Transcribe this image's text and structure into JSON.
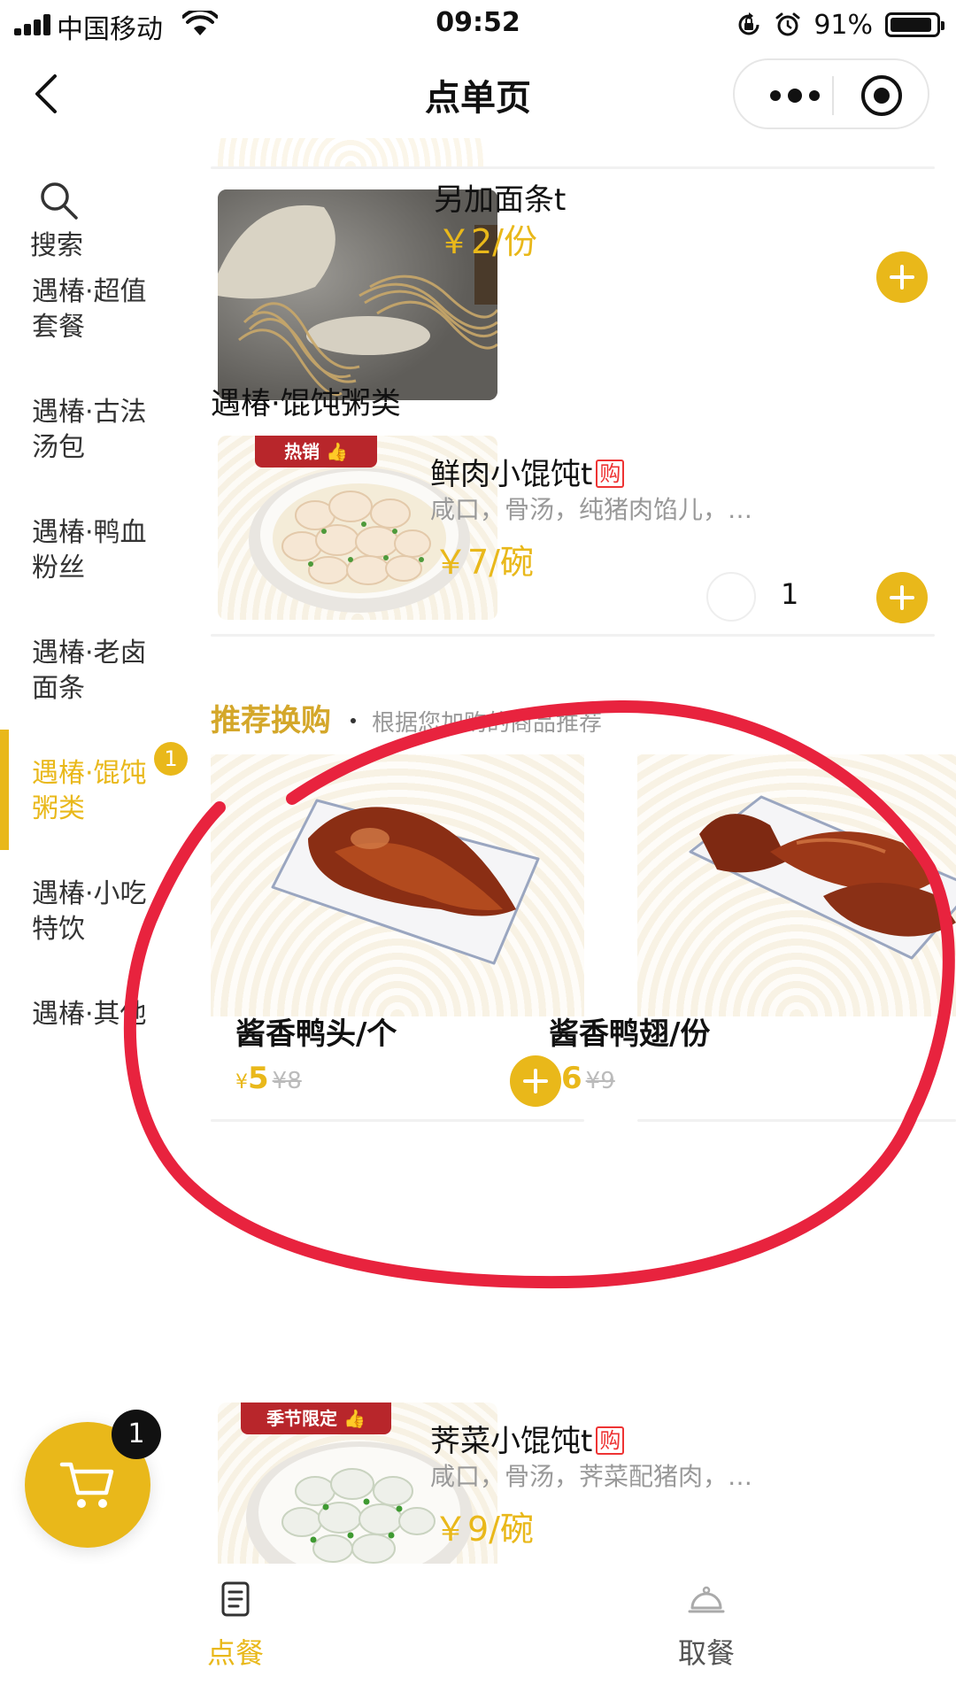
{
  "status_bar": {
    "carrier": "中国移动",
    "time": "09:52",
    "battery_percent": "91%",
    "battery_level": 0.91
  },
  "navbar": {
    "title": "点单页"
  },
  "sidebar": {
    "search_label": "搜索",
    "categories": [
      {
        "line1": "遇椿·超值",
        "line2": "套餐"
      },
      {
        "line1": "遇椿·古法",
        "line2": "汤包"
      },
      {
        "line1": "遇椿·鸭血",
        "line2": "粉丝"
      },
      {
        "line1": "遇椿·老卤",
        "line2": "面条"
      },
      {
        "line1": "遇椿·馄饨",
        "line2": "粥类",
        "badge": "1"
      },
      {
        "line1": "遇椿·小吃",
        "line2": "特饮"
      },
      {
        "line1": "遇椿·其他",
        "line2": ""
      }
    ]
  },
  "items": {
    "extra_noodles": {
      "name": "另加面条t",
      "price": "￥2/份"
    },
    "section_wonton": "遇椿·馄饨粥类",
    "fresh_wonton": {
      "tag": "热销",
      "name": "鲜肉小馄饨t",
      "buy_tag": "购",
      "desc": "咸口，骨汤，纯猪肉馅儿，…",
      "price": "￥7/碗",
      "qty": "1"
    },
    "shepherd_wonton": {
      "tag": "季节限定",
      "name": "荠菜小馄饨t",
      "buy_tag": "购",
      "desc": "咸口，骨汤，荠菜配猪肉，…",
      "price": "￥9/碗"
    }
  },
  "recommend": {
    "title": "推荐换购",
    "subtitle": "根据您加购的商品推荐",
    "cards": [
      {
        "name": "酱香鸭头/个",
        "currency": "¥",
        "price": "5",
        "old_price": "¥8"
      },
      {
        "name": "酱香鸭翅/份",
        "currency": "¥",
        "price": "6",
        "old_price": "¥9"
      }
    ]
  },
  "cart": {
    "count": "1"
  },
  "tabbar": {
    "tabs": [
      {
        "label": "点餐"
      },
      {
        "label": "取餐"
      }
    ]
  },
  "colors": {
    "accent": "#e9b81a",
    "annotation": "#e8233e"
  }
}
